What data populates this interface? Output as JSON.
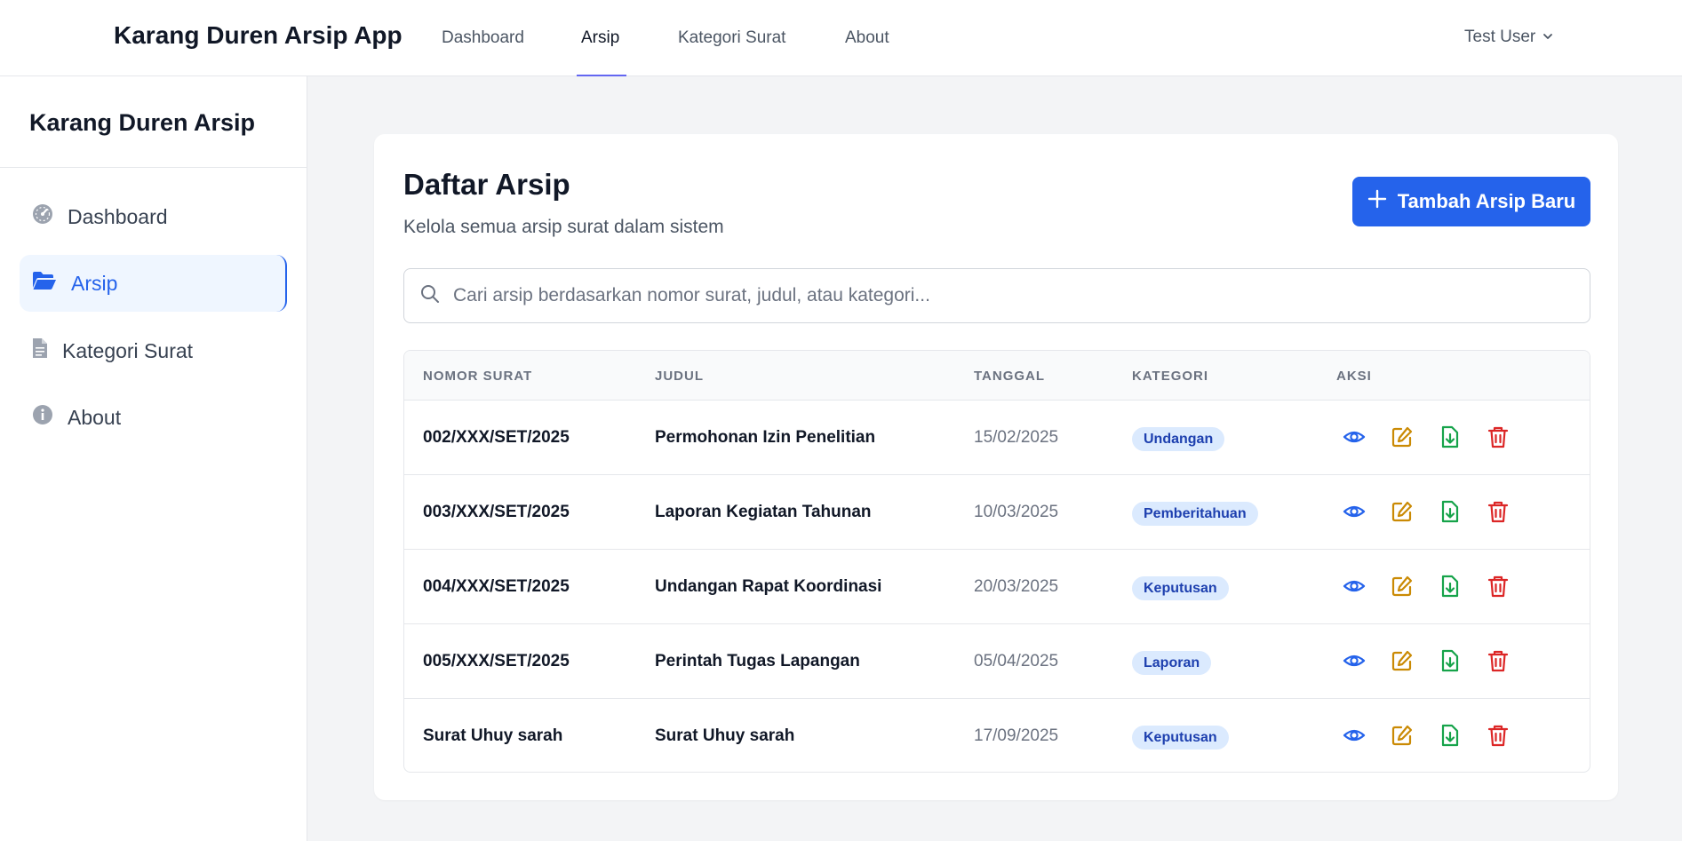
{
  "app": {
    "title": "Karang Duren Arsip App"
  },
  "topnav": {
    "links": [
      "Dashboard",
      "Arsip",
      "Kategori Surat",
      "About"
    ],
    "active": "Arsip",
    "user": "Test User"
  },
  "sidebar": {
    "title": "Karang Duren Arsip",
    "items": [
      {
        "label": "Dashboard",
        "icon": "gauge-icon"
      },
      {
        "label": "Arsip",
        "icon": "folder-open-icon",
        "active": true
      },
      {
        "label": "Kategori Surat",
        "icon": "document-icon"
      },
      {
        "label": "About",
        "icon": "info-icon"
      }
    ]
  },
  "main": {
    "title": "Daftar Arsip",
    "subtitle": "Kelola semua arsip surat dalam sistem",
    "add_button": "Tambah Arsip Baru",
    "search_placeholder": "Cari arsip berdasarkan nomor surat, judul, atau kategori...",
    "columns": [
      "Nomor Surat",
      "Judul",
      "Tanggal",
      "Kategori",
      "Aksi"
    ],
    "rows": [
      {
        "nomor": "002/XXX/SET/2025",
        "judul": "Permohonan Izin Penelitian",
        "tanggal": "15/02/2025",
        "kategori": "Undangan"
      },
      {
        "nomor": "003/XXX/SET/2025",
        "judul": "Laporan Kegiatan Tahunan",
        "tanggal": "10/03/2025",
        "kategori": "Pemberitahuan"
      },
      {
        "nomor": "004/XXX/SET/2025",
        "judul": "Undangan Rapat Koordinasi",
        "tanggal": "20/03/2025",
        "kategori": "Keputusan"
      },
      {
        "nomor": "005/XXX/SET/2025",
        "judul": "Perintah Tugas Lapangan",
        "tanggal": "05/04/2025",
        "kategori": "Laporan"
      },
      {
        "nomor": "Surat Uhuy sarah",
        "judul": "Surat Uhuy sarah",
        "tanggal": "17/09/2025",
        "kategori": "Keputusan"
      }
    ]
  },
  "colors": {
    "primary": "#2563eb",
    "view": "#2563eb",
    "edit": "#ca8a04",
    "download": "#16a34a",
    "delete": "#dc2626",
    "badge_bg": "#dbeafe",
    "badge_text": "#1e40af"
  }
}
